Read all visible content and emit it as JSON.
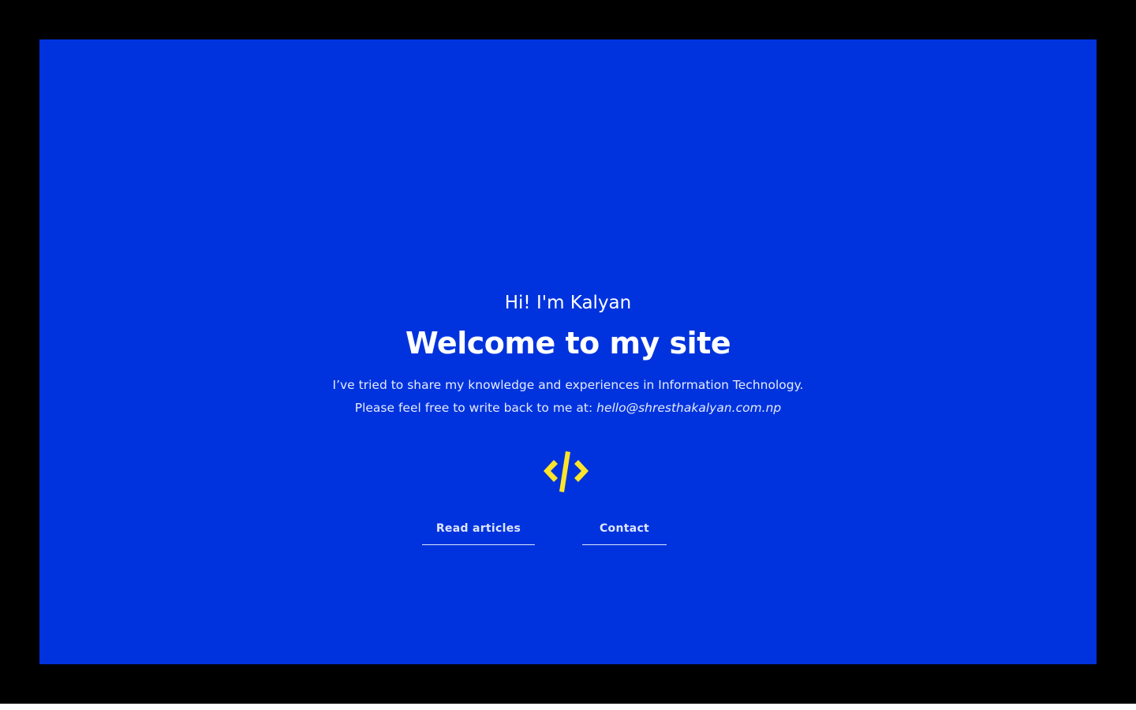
{
  "hero": {
    "greeting": "Hi! I'm Kalyan",
    "title": "Welcome to my site",
    "description_line_1": "I’ve tried to share my knowledge and experiences in Information Technology.",
    "description_line_2_prefix": "Please feel free to write back to me at: ",
    "email": "hello@shresthakalyan.com.np",
    "logo_icon": "code-brackets-icon",
    "background_color": "#0033dd",
    "logo_color": "#ffe52a"
  },
  "nav": {
    "read_articles_label": "Read articles",
    "contact_label": "Contact"
  }
}
